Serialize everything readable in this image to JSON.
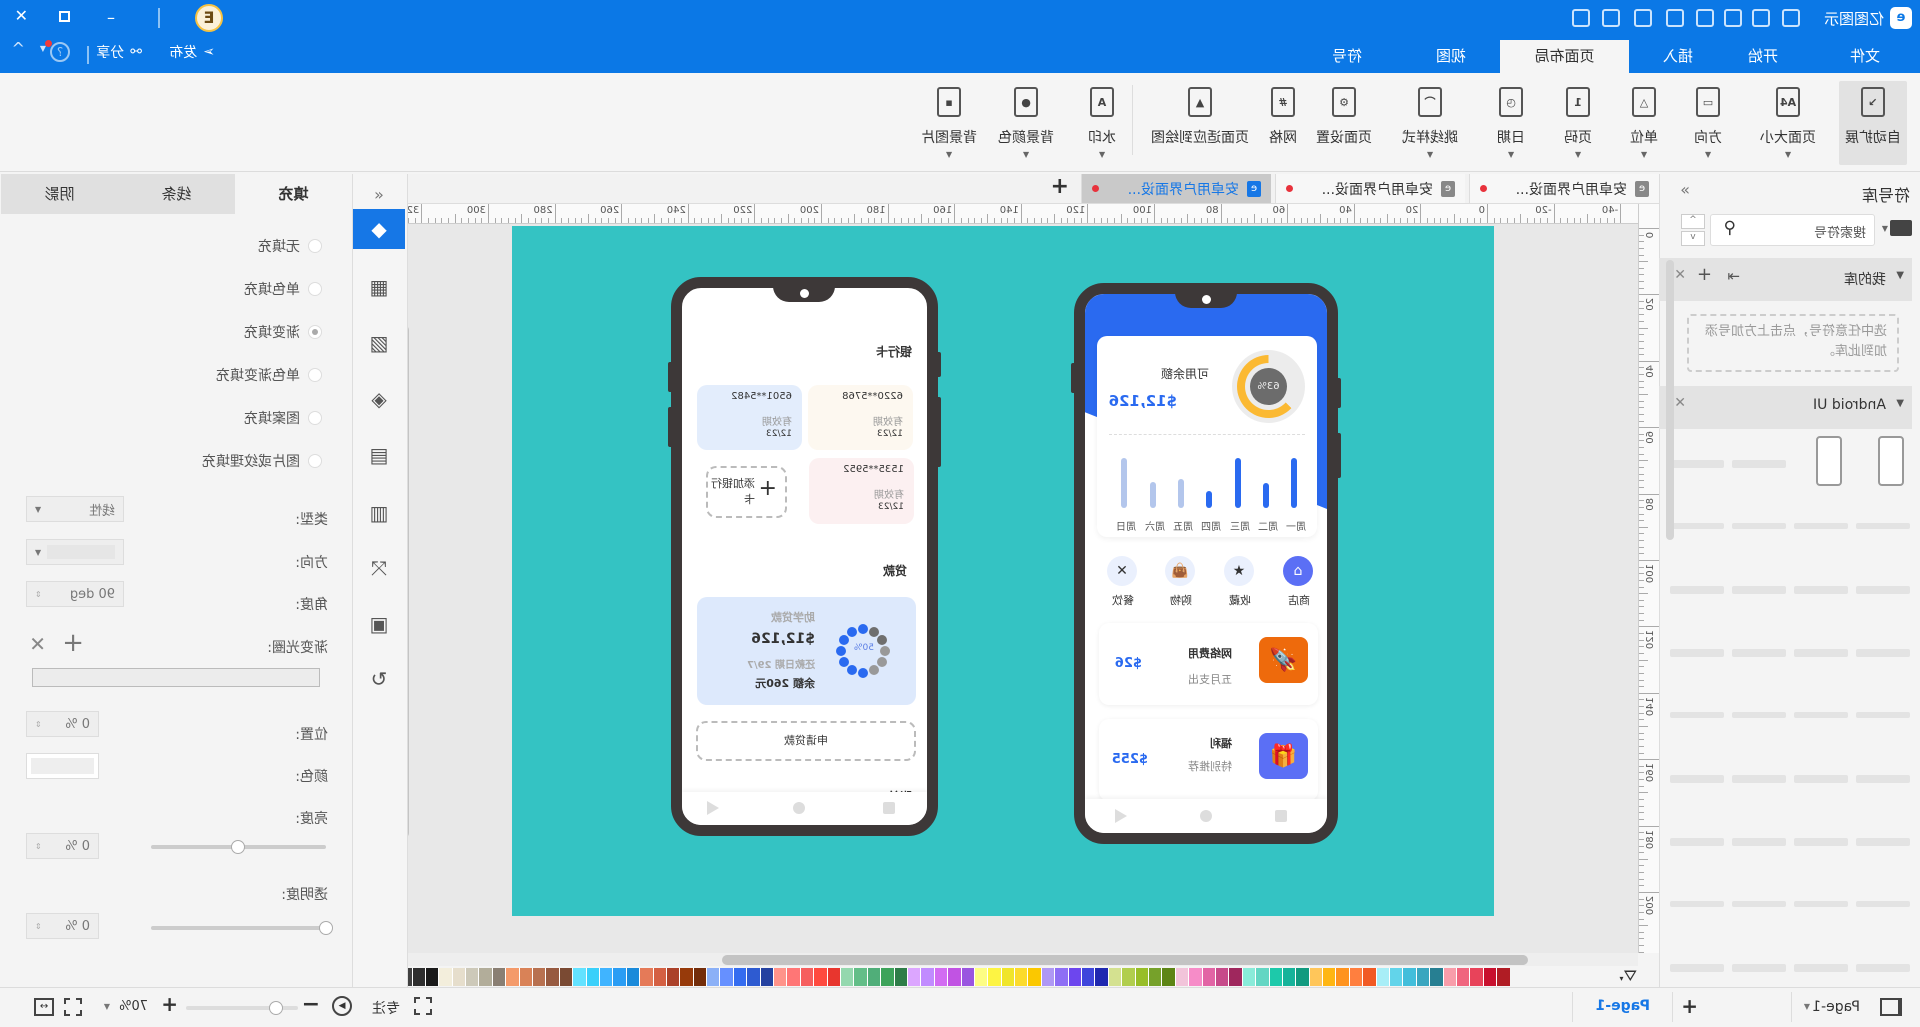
{
  "app": {
    "title": "亿图图示",
    "accent": "#1677e6",
    "titlebar_color": "#0b78e6",
    "page_color": "#34c3c3"
  },
  "titlebar": {
    "quick_icons": [
      "redo-icon",
      "undo-icon",
      "new-icon",
      "open-icon",
      "save-icon",
      "print-icon",
      "export-icon",
      "more-icon"
    ],
    "user_badge": "E",
    "window_controls": [
      "minimize-icon",
      "restore-icon",
      "close-icon"
    ]
  },
  "menu": {
    "tabs": [
      "文件",
      "开始",
      "插入",
      "页面布局",
      "视图",
      "符号"
    ],
    "active": "页面布局",
    "publish": "发布",
    "share": "分享"
  },
  "ribbon": {
    "items": [
      {
        "label": "自动扩展",
        "icon": "auto-expand-icon",
        "glyph": "↘",
        "caret": false,
        "active": true
      },
      {
        "label": "页面大小",
        "icon": "page-size-icon",
        "glyph": "A4",
        "caret": true
      },
      {
        "label": "方向",
        "icon": "orientation-icon",
        "glyph": "▭",
        "caret": true
      },
      {
        "label": "单位",
        "icon": "unit-icon",
        "glyph": "△",
        "caret": true
      },
      {
        "label": "页码",
        "icon": "page-number-icon",
        "glyph": "1",
        "caret": true
      },
      {
        "label": "日期",
        "icon": "date-icon",
        "glyph": "◷",
        "caret": true
      },
      {
        "label": "跳线样式",
        "icon": "jump-line-icon",
        "glyph": "⌒",
        "caret": true
      },
      {
        "label": "页面设置",
        "icon": "page-setup-icon",
        "glyph": "⚙",
        "caret": false
      },
      {
        "label": "网格",
        "icon": "grid-icon",
        "glyph": "#",
        "caret": false
      },
      {
        "label": "页面适应到绘图",
        "icon": "fit-to-drawing-icon",
        "glyph": "▲",
        "caret": false
      },
      {
        "label": "水印",
        "icon": "watermark-icon",
        "glyph": "A",
        "caret": true
      },
      {
        "label": "背景颜色",
        "icon": "background-color-icon",
        "glyph": "●",
        "caret": true
      },
      {
        "label": "背景图片",
        "icon": "background-image-icon",
        "glyph": "▪",
        "caret": true
      }
    ]
  },
  "doc_tabs": [
    {
      "label": "安卓用户界面设...",
      "active": false
    },
    {
      "label": "安卓用户界面设...",
      "active": false
    },
    {
      "label": "安卓用户界面设...",
      "active": true
    }
  ],
  "ruler": {
    "h": [
      "-40",
      "-20",
      "0",
      "20",
      "40",
      "60",
      "80",
      "100",
      "120",
      "140",
      "160",
      "180",
      "200",
      "220",
      "240",
      "260",
      "280",
      "300",
      "320"
    ],
    "v": [
      "0",
      "20",
      "40",
      "60",
      "80",
      "100",
      "120",
      "140",
      "160",
      "180",
      "200"
    ]
  },
  "symbols": {
    "title": "符号库",
    "search_placeholder": "搜索符号",
    "my_library": "我的库",
    "my_library_hint": "选中任意符号，点击上方加号添加到此库。",
    "android_ui": "Android UI"
  },
  "side_icons": [
    "fill-icon",
    "grid-layout-icon",
    "image-icon",
    "layers-icon",
    "document-icon",
    "dashboard-icon",
    "connect-icon",
    "presentation-icon",
    "history-icon"
  ],
  "properties": {
    "tabs": [
      "填充",
      "线条",
      "阴影"
    ],
    "fill_options": [
      "无填充",
      "单色填充",
      "渐变填充",
      "单色渐变填充",
      "图案填充",
      "图片或纹理填充"
    ],
    "selected_option": 2,
    "type_label": "类型:",
    "type_value": "线性",
    "direction_label": "方向:",
    "angle_label": "角度:",
    "angle_value": "90 deg",
    "stops_label": "渐变光圈:",
    "position_label": "位置:",
    "position_value": "0 %",
    "color_label": "颜色:",
    "brightness_label": "亮度:",
    "brightness_value": "0 %",
    "brightness_slider": 0.5,
    "transparency_label": "透明度:",
    "transparency_value": "0 %",
    "transparency_slider": 0
  },
  "palette": [
    "#FFFFFF",
    "#F2F2F2",
    "#E6E6E6",
    "#DADADA",
    "#CCCCCC",
    "#B8B8B8",
    "#7F7F7F",
    "#595959",
    "#404040",
    "#2E2E2E",
    "#1A1A1A",
    "#F3EEDC",
    "#E6DECC",
    "#CDC9B9",
    "#B2AD9A",
    "#8A7F73",
    "#F49A6A",
    "#D98257",
    "#B87150",
    "#975A40",
    "#7A4A33",
    "#63E2FF",
    "#3AD0FA",
    "#40B4FF",
    "#2A9DF4",
    "#1A8ADA",
    "#E57A58",
    "#D46043",
    "#AB4129",
    "#973A0A",
    "#732D0A",
    "#8BB0F7",
    "#6690FF",
    "#346CF0",
    "#2E5BD1",
    "#2441A0",
    "#FF938A",
    "#FF7676",
    "#F65E5E",
    "#FF4A3F",
    "#E8362E",
    "#94D8AE",
    "#63BE88",
    "#50AE79",
    "#3DA35A",
    "#2E7D48",
    "#DCA6FF",
    "#C18BFF",
    "#D26CF2",
    "#C153E3",
    "#9A56E0",
    "#FDFD84",
    "#FDF443",
    "#F0E52A",
    "#FCDB2C",
    "#FBC800",
    "#AF98F4",
    "#8E6EF5",
    "#6D46EE",
    "#3E45DC",
    "#1F28B0",
    "#D4E190",
    "#B1CE4E",
    "#98BE28",
    "#76A12A",
    "#5D8515",
    "#F2C4DA",
    "#F68CC8",
    "#E264A5",
    "#C74A8A",
    "#9F275D",
    "#89EBD9",
    "#63D6C3",
    "#1DC9AA",
    "#16B39A",
    "#119A7F",
    "#FFC65A",
    "#FFB612",
    "#FF931E",
    "#FF7F3F",
    "#F15A24",
    "#A8EEF7",
    "#62D4EA",
    "#42BEDB",
    "#3AA6BF",
    "#277F92",
    "#F89DAA",
    "#F0657E",
    "#E8435A",
    "#C8102E",
    "#B01C24"
  ],
  "status": {
    "page_label": "Page-1",
    "active_page": "Page-1",
    "zoom": "70%",
    "focus": "专注",
    "zoom_slider": 0.2
  },
  "phone_dashboard": {
    "balance_label": "可用余额",
    "balance": "$12,126",
    "usage_percent": "63%",
    "usage_fraction": 0.63,
    "days": [
      "周一",
      "周二",
      "周三",
      "周四",
      "周五",
      "周六",
      "周日"
    ],
    "day_levels": [
      1.0,
      0.5,
      1.0,
      0.34,
      0.58,
      0.52,
      1.0
    ],
    "shortcuts": [
      {
        "label": "商店",
        "icon": "store-icon"
      },
      {
        "label": "收藏",
        "icon": "star-icon"
      },
      {
        "label": "购物",
        "icon": "shopping-bag-icon"
      },
      {
        "label": "餐饮",
        "icon": "dining-icon"
      }
    ],
    "items": [
      {
        "title": "网络费用",
        "subtitle": "五月支出",
        "amount": "$26",
        "icon": "rocket-icon",
        "color": "#ee6a0c"
      },
      {
        "title": "福利",
        "subtitle": "特别推荐",
        "amount": "$255",
        "icon": "gift-icon",
        "color": "#5b6ff5"
      }
    ]
  },
  "phone_wallet": {
    "cards_title": "银行卡",
    "cards": [
      {
        "number": "6220**5768",
        "expiry_label": "有效期",
        "expiry": "12/23",
        "color": "#fdf8f0"
      },
      {
        "number": "6501**5482",
        "expiry_label": "有效期",
        "expiry": "12/23",
        "color": "#e3edfc"
      },
      {
        "number": "1535**5952",
        "expiry_label": "有效期",
        "expiry": "12/23",
        "color": "#fcf0f1"
      }
    ],
    "add_card": "添加银行卡",
    "loan_title": "贷款",
    "loan": {
      "name": "助学贷款",
      "amount": "$12,126",
      "due": "还款日期 29/7",
      "balance": "余额  260元",
      "progress": "50%",
      "progress_fraction": 0.5
    },
    "apply_button": "申请贷款",
    "bills_title": "账单"
  }
}
